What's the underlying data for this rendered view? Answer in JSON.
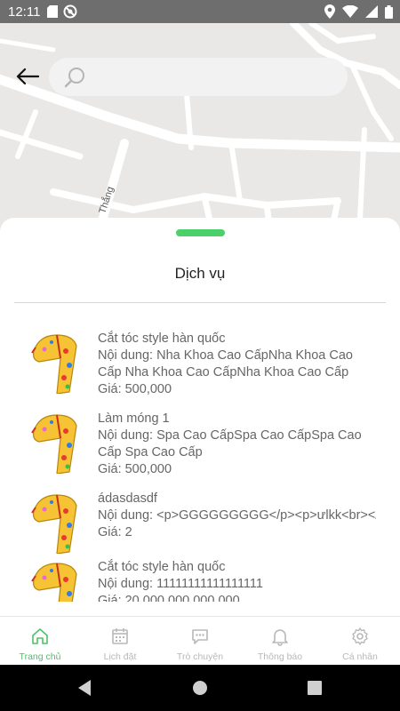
{
  "status_bar": {
    "time": "12:11"
  },
  "map": {
    "street_label": "Thắng"
  },
  "search": {
    "placeholder": "",
    "value": ""
  },
  "sheet": {
    "title": "Dịch vụ"
  },
  "services": [
    {
      "title": "Cắt tóc style hàn quốc",
      "content": "Nội dung: Nha Khoa Cao CấpNha Khoa Cao Cấp Nha Khoa Cao CấpNha Khoa Cao Cấp",
      "price": "Giá: 500,000"
    },
    {
      "title": "Làm móng 1",
      "content": "Nội dung: Spa Cao CấpSpa Cao CấpSpa Cao Cấp Spa Cao Cấp",
      "price": "Giá: 500,000"
    },
    {
      "title": "ádasdasdf",
      "content": "Nội dung: <p>GGGGGGGGG</p><p>ưlkk<br></p>",
      "price": "Giá: 2"
    },
    {
      "title": "Cắt tóc style hàn quốc",
      "content": "Nội dung: 11111111111111111",
      "price": "Giá: 20,000,000,000,000"
    }
  ],
  "nav": {
    "home": "Trang chủ",
    "schedule": "Lịch đặt",
    "chat": "Trò chuyện",
    "notifications": "Thông báo",
    "profile": "Cá nhân"
  },
  "colors": {
    "accent": "#4cc266",
    "inactive": "#b8b8b8",
    "status_bar": "#6e6e6e"
  }
}
